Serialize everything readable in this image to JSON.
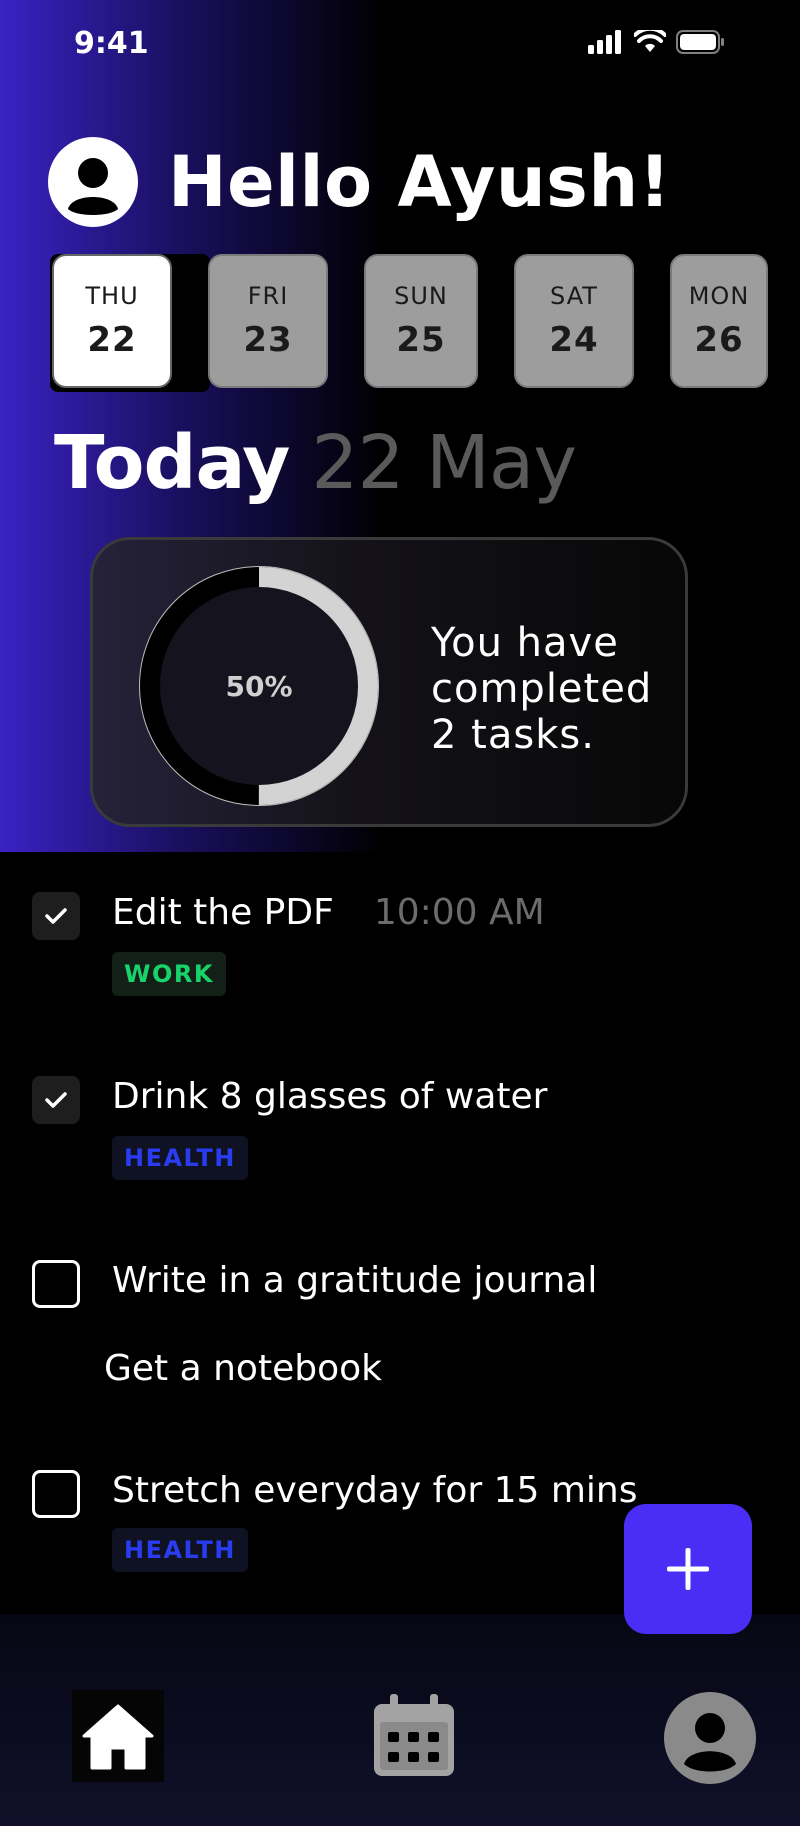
{
  "status_bar": {
    "time": "9:41"
  },
  "header": {
    "greeting": "Hello Ayush!"
  },
  "days": [
    {
      "name": "THU",
      "num": "22",
      "selected": true
    },
    {
      "name": "FRI",
      "num": "23",
      "selected": false
    },
    {
      "name": "SUN",
      "num": "25",
      "selected": false
    },
    {
      "name": "SAT",
      "num": "24",
      "selected": false
    },
    {
      "name": "MON",
      "num": "26",
      "selected": false
    }
  ],
  "today": {
    "label": "Today",
    "date": "22 May"
  },
  "progress": {
    "percent_label": "50%",
    "fraction": 0.5,
    "text": "You have completed 2 tasks."
  },
  "tasks": [
    {
      "title": "Edit the PDF",
      "time": "10:00 AM",
      "done": true,
      "tag": "WORK"
    },
    {
      "title": "Drink 8 glasses of water",
      "done": true,
      "tag": "HEALTH"
    },
    {
      "title": "Write in a gratitude journal",
      "done": false,
      "subtask": "Get a notebook"
    },
    {
      "title": "Stretch everyday for 15 mins",
      "done": false,
      "tag": "HEALTH"
    }
  ],
  "fab": {
    "icon": "plus-icon"
  },
  "nav": [
    {
      "icon": "home-icon",
      "active": true
    },
    {
      "icon": "calendar-icon",
      "active": false
    },
    {
      "icon": "profile-icon",
      "active": false
    }
  ],
  "colors": {
    "accent": "#4a2ef5",
    "work_tag": "#18d36a",
    "health_tag": "#2a3cf0",
    "day_inactive": "#9d9d9d",
    "muted_text": "#5a5a5a"
  }
}
